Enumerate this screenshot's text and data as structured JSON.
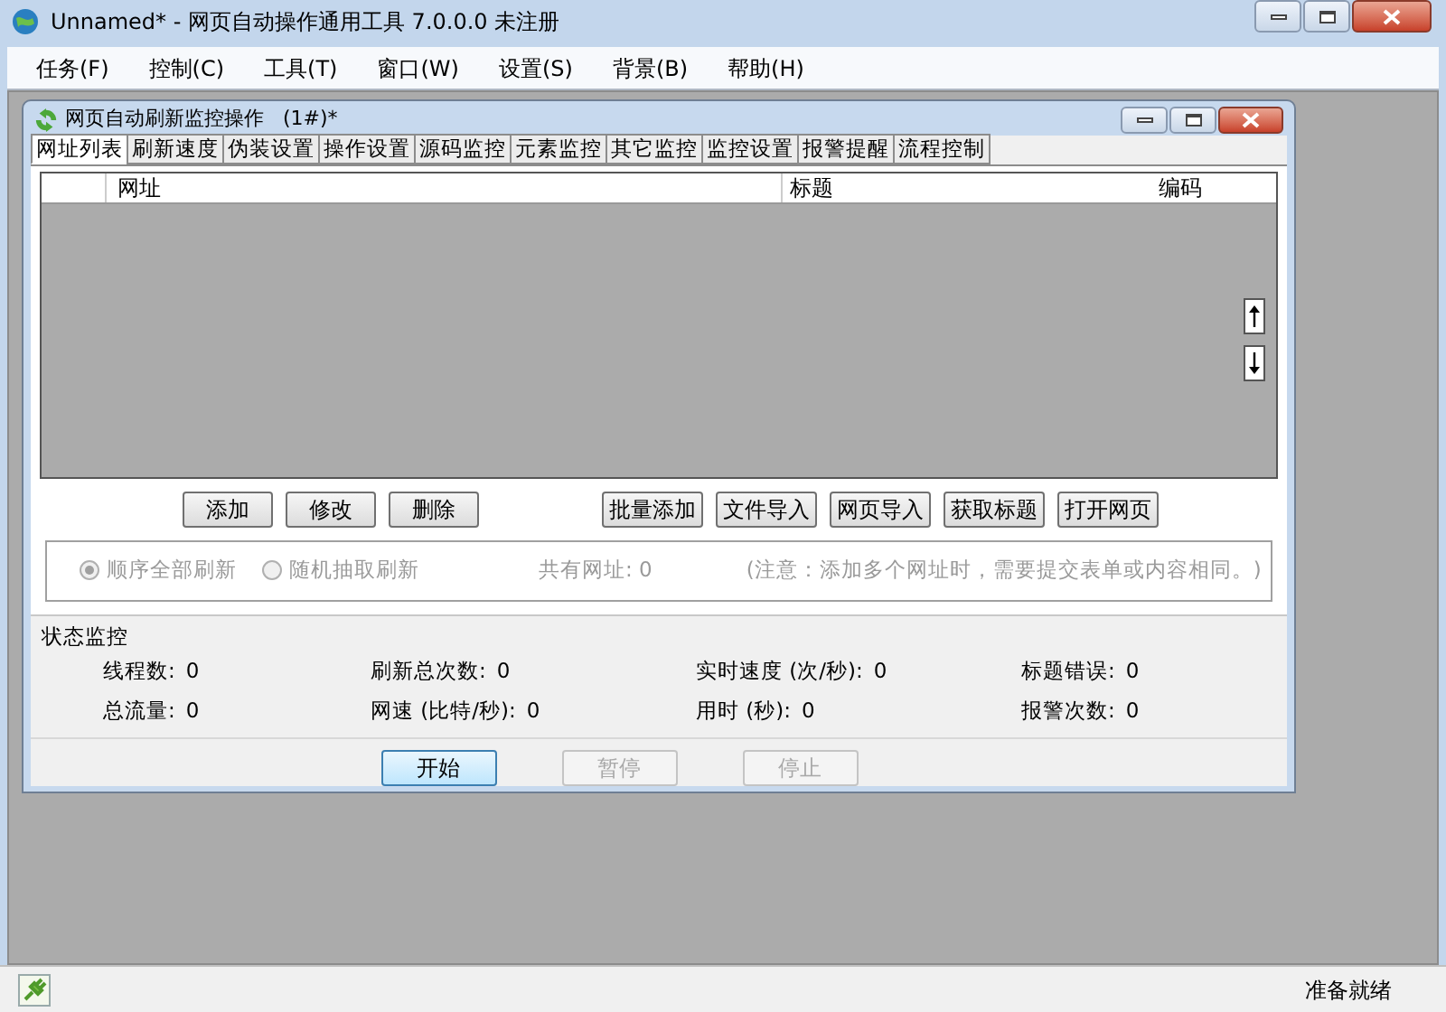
{
  "window": {
    "title": "Unnamed* - 网页自动操作通用工具 7.0.0.0  未注册"
  },
  "menu": [
    "任务(F)",
    "控制(C)",
    "工具(T)",
    "窗口(W)",
    "设置(S)",
    "背景(B)",
    "帮助(H)"
  ],
  "child_window": {
    "title": "网页自动刷新监控操作   (1#)*",
    "tabs": [
      {
        "label": "网址列表",
        "selected": true
      },
      {
        "label": "刷新速度",
        "selected": false
      },
      {
        "label": "伪装设置",
        "selected": false
      },
      {
        "label": "操作设置",
        "selected": false
      },
      {
        "label": "源码监控",
        "selected": false
      },
      {
        "label": "元素监控",
        "selected": false
      },
      {
        "label": "其它监控",
        "selected": false
      },
      {
        "label": "监控设置",
        "selected": false
      },
      {
        "label": "报警提醒",
        "selected": false
      },
      {
        "label": "流程控制",
        "selected": false
      }
    ],
    "table": {
      "columns": [
        "网址",
        "标题",
        "编码"
      ]
    },
    "button_groups": [
      [
        "添加",
        "修改",
        "删除"
      ],
      [
        "批量添加",
        "文件导入",
        "网页导入",
        "获取标题",
        "打开网页"
      ]
    ],
    "radios": [
      {
        "label": "顺序全部刷新",
        "selected": true
      },
      {
        "label": "随机抽取刷新",
        "selected": false
      }
    ],
    "url_count": "共有网址: 0",
    "note": "(注意：添加多个网址时，需要提交表单或内容相同。)",
    "status_monitor": {
      "title": "状态监控",
      "fields": [
        {
          "label": "线程数:",
          "value": "0"
        },
        {
          "label": "刷新总次数:",
          "value": "0"
        },
        {
          "label": "实时速度 (次/秒):",
          "value": "0"
        },
        {
          "label": "标题错误:",
          "value": "0"
        },
        {
          "label": "总流量:",
          "value": "0"
        },
        {
          "label": "网速 (比特/秒):",
          "value": "0"
        },
        {
          "label": "用时 (秒):",
          "value": "0"
        },
        {
          "label": "报警次数:",
          "value": "0"
        }
      ]
    },
    "actions": [
      {
        "label": "开始",
        "disabled": false
      },
      {
        "label": "暂停",
        "disabled": true
      },
      {
        "label": "停止",
        "disabled": true
      }
    ]
  },
  "status_bar": {
    "text": "准备就绪"
  }
}
